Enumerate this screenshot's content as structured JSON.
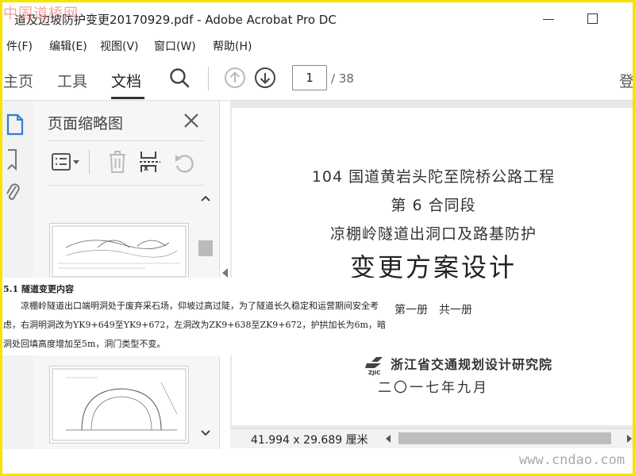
{
  "window": {
    "title": "道及边坡防护变更20170929.pdf - Adobe Acrobat Pro DC",
    "watermark": "中国道桥网",
    "footer_watermark": "www.cndao.com"
  },
  "menu": [
    "件(F)",
    "编辑(E)",
    "视图(V)",
    "窗口(W)",
    "帮助(H)"
  ],
  "toolbar": {
    "tabs": [
      "主页",
      "工具",
      "文档"
    ],
    "active_tab": "文档",
    "current_page": "1",
    "total_pages": "/ 38",
    "signin_label": "登",
    "icons": [
      "search-icon",
      "page-up-icon",
      "page-down-icon"
    ]
  },
  "thumb_panel": {
    "title": "页面缩略图",
    "icons": [
      "options-menu-icon",
      "trash-icon",
      "extract-icon",
      "rotate-icon",
      "close-icon"
    ]
  },
  "document": {
    "lines": [
      "104 国道黄岩头陀至院桥公路工程",
      "第 6 合同段",
      "凉棚岭隧道出洞口及路基防护",
      "变更方案设计",
      "第一册　共一册"
    ],
    "org_abbr": "ZJIC",
    "org_name": "浙江省交通规划设计研究院",
    "date": "二〇一七年九月",
    "page_size": "41.994 x 29.689 厘米"
  },
  "excerpt": {
    "heading": "5.1  隧道变更内容",
    "paragraph": "凉棚岭隧道出口端明洞处于废弃采石场，仰坡过高过陡，为了隧道长久稳定和运营期间安全考虑，右洞明洞改为YK9+649至YK9+672，左洞改为ZK9+638至ZK9+672，护拱加长为6m，暗洞处回填高度增加至5m，洞门类型不变。"
  }
}
